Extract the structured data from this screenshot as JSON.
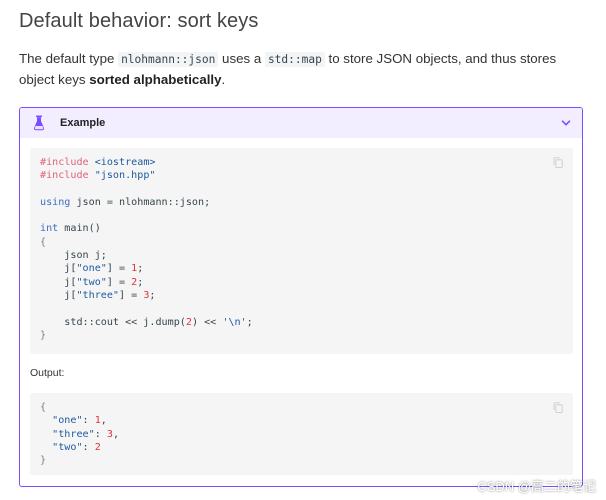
{
  "page": {
    "title": "Default behavior: sort keys",
    "para": {
      "t1": "The default type ",
      "c1": "nlohmann::json",
      "t2": " uses a ",
      "c2": "std::map",
      "t3": " to store JSON objects, and thus stores object keys ",
      "b1": "sorted alphabetically",
      "t4": "."
    }
  },
  "admonition": {
    "title": "Example",
    "icon": "flask-icon",
    "accent_color": "#7c4dff",
    "header_bg": "#f2edff"
  },
  "code": {
    "include1": "#include",
    "header1": "<iostream>",
    "include2": "#include",
    "header2": "\"json.hpp\"",
    "using_kw": "using",
    "using_rest": " json = nlohmann::json;",
    "int_kw": "int",
    "main": " main()",
    "open_brace": "{",
    "decl": "    json j;",
    "j1": "    j[",
    "k_one": "\"one\"",
    "v_one": "1",
    "k_two": "\"two\"",
    "v_two": "2",
    "k_three": "\"three\"",
    "v_three": "3",
    "cout_start": "    std::cout << j.dump(",
    "dump_arg": "2",
    "cout_mid": ") << ",
    "newline_str": "'\\n'",
    "close_brace": "}"
  },
  "output_label": "Output:",
  "output": {
    "k_one": "\"one\"",
    "v_one": "1",
    "k_three": "\"three\"",
    "v_three": "3",
    "k_two": "\"two\"",
    "v_two": "2"
  },
  "watermark": "CSDN @高二的笔记"
}
